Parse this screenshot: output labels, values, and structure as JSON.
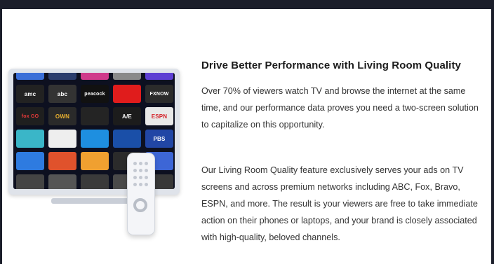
{
  "feature": {
    "title": "Drive Better Performance with Living Room Quality",
    "paragraph1": "Over 70% of viewers watch TV and browse the internet at the same time, and our performance data proves you need a two-screen solution to capitalize on this opportunity.",
    "paragraph2": "Our Living Room Quality feature exclusively serves your ads on TV screens and across premium networks including ABC, Fox, Bravo, ESPN, and more. The result is your viewers are free to take immediate action on their phones or laptops, and your brand is closely associated with high-quality, beloved channels."
  },
  "tv_channels": [
    "amc",
    "abc",
    "peacock",
    "",
    "FXNOW",
    "fox GO",
    "OWN",
    "",
    "A/E",
    "ESPN",
    "",
    "",
    "",
    "",
    "PBS"
  ],
  "colors": {
    "background": "#ffffff",
    "frame": "#1b1e2a",
    "title": "#1c1c1c",
    "body_text": "#333333"
  },
  "icons": [
    "tv-icon",
    "remote-control-icon"
  ]
}
